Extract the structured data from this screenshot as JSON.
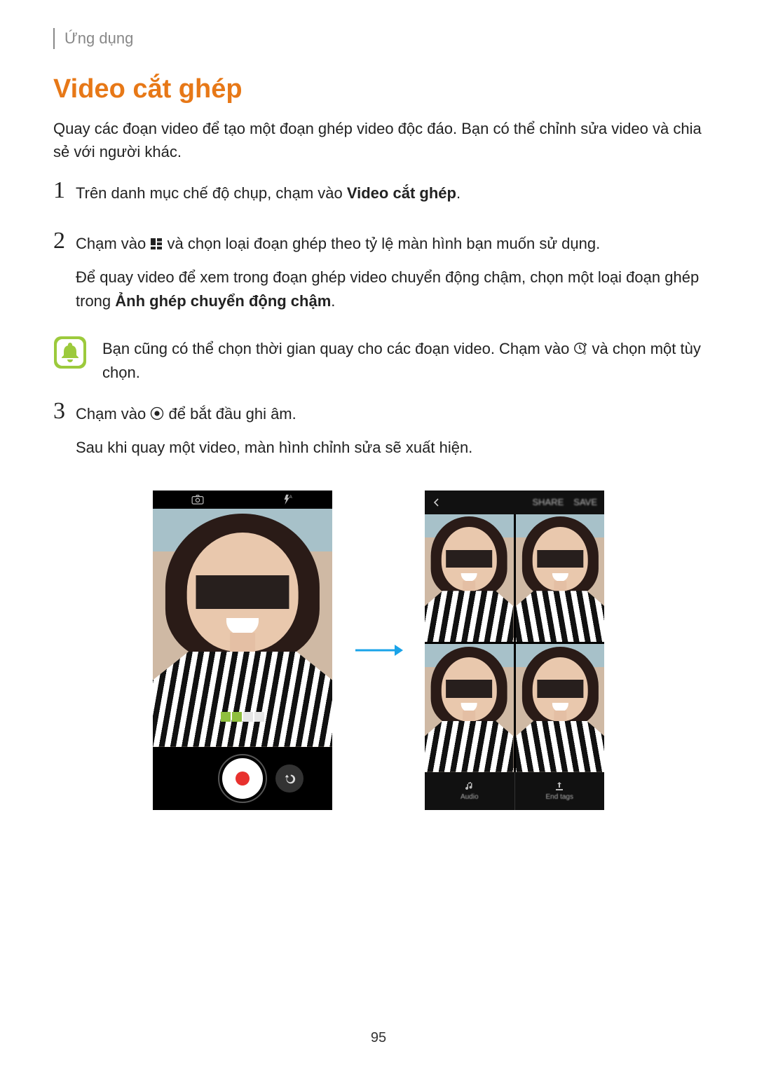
{
  "header": {
    "breadcrumb": "Ứng dụng"
  },
  "title": "Video cắt ghép",
  "intro": "Quay các đoạn video để tạo một đoạn ghép video độc đáo. Bạn có thể chỉnh sửa video và chia sẻ với người khác.",
  "steps": [
    {
      "num": "1",
      "parts": [
        {
          "t": "Trên danh mục chế độ chụp, chạm vào "
        },
        {
          "t": "Video cắt ghép",
          "bold": true
        },
        {
          "t": "."
        }
      ]
    },
    {
      "num": "2",
      "parts": [
        {
          "t": "Chạm vào "
        },
        {
          "icon": "grid-icon"
        },
        {
          "t": " và chọn loại đoạn ghép theo tỷ lệ màn hình bạn muốn sử dụng."
        }
      ],
      "parts2": [
        {
          "t": "Để quay video để xem trong đoạn ghép video chuyển động chậm, chọn một loại đoạn ghép trong "
        },
        {
          "t": "Ảnh ghép chuyển động chậm",
          "bold": true
        },
        {
          "t": "."
        }
      ]
    },
    {
      "num": "3",
      "parts": [
        {
          "t": "Chạm vào "
        },
        {
          "icon": "record-icon"
        },
        {
          "t": " để bắt đầu ghi âm."
        }
      ],
      "parts2": [
        {
          "t": "Sau khi quay một video, màn hình chỉnh sửa sẽ xuất hiện."
        }
      ]
    }
  ],
  "note": {
    "parts": [
      {
        "t": "Bạn cũng có thể chọn thời gian quay cho các đoạn video. Chạm vào "
      },
      {
        "icon": "clock-icon"
      },
      {
        "t": " và chọn một tùy chọn."
      }
    ]
  },
  "figure": {
    "phone_b_topbar": {
      "action_share": "SHARE",
      "action_save": "SAVE"
    },
    "phone_b_bottom": {
      "left_label": "Audio",
      "right_label": "End tags"
    }
  },
  "page_number": "95"
}
